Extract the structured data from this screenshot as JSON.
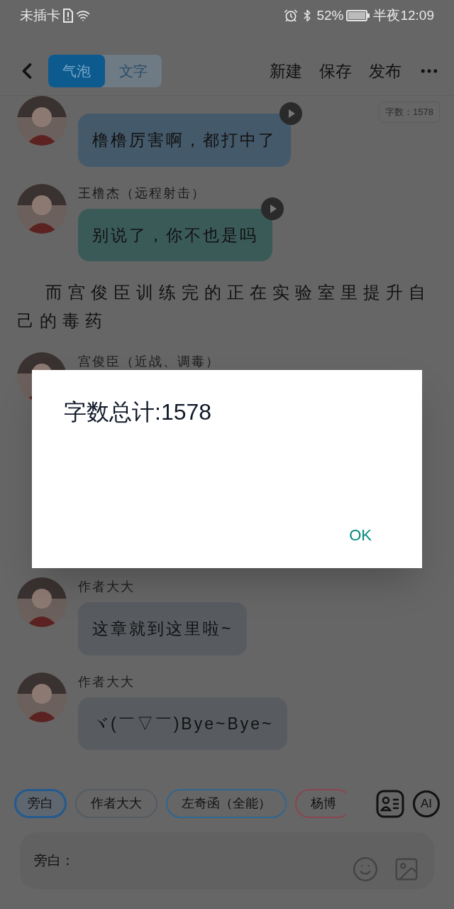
{
  "status_bar": {
    "carrier": "未插卡",
    "battery_percent": "52%",
    "time": "半夜12:09"
  },
  "header": {
    "tabs": [
      {
        "label": "气泡",
        "selected": true
      },
      {
        "label": "文字",
        "selected": false
      }
    ],
    "actions": [
      "新建",
      "保存",
      "发布"
    ]
  },
  "word_count_badge": "字数：1578",
  "messages": [
    {
      "kind": "bubble",
      "text": "橹橹厉害啊，都打中了",
      "color": "#44596a",
      "voice": true
    },
    {
      "kind": "bubble",
      "name": "王橹杰（远程射击）",
      "text": "别说了，你不也是吗",
      "color": "#3a5a58",
      "voice": true
    },
    {
      "kind": "narration",
      "text": "而宫俊臣训练完的正在实验室里提升自己的毒药"
    },
    {
      "kind": "covered",
      "name": "宫俊臣（近战、调毒）"
    },
    {
      "kind": "bubble",
      "name": "作者大大",
      "text": "这章就到这里啦~",
      "color": "#585c61",
      "voice": false
    },
    {
      "kind": "bubble",
      "name": "作者大大",
      "text": "ヾ(￣▽￣)Bye~Bye~",
      "color": "#585c61",
      "voice": false
    }
  ],
  "characters": [
    {
      "label": "旁白",
      "color": "#245a8e",
      "selected": true
    },
    {
      "label": "作者大大",
      "color": "#555b63",
      "selected": false
    },
    {
      "label": "左奇函（全能）",
      "color": "#2f6690",
      "selected": false
    },
    {
      "label": "杨博",
      "color": "#8a4550",
      "selected": false
    }
  ],
  "ai_button": "AI",
  "input": {
    "label": "旁白："
  },
  "dialog": {
    "message": "字数总计:1578",
    "button": "OK"
  }
}
